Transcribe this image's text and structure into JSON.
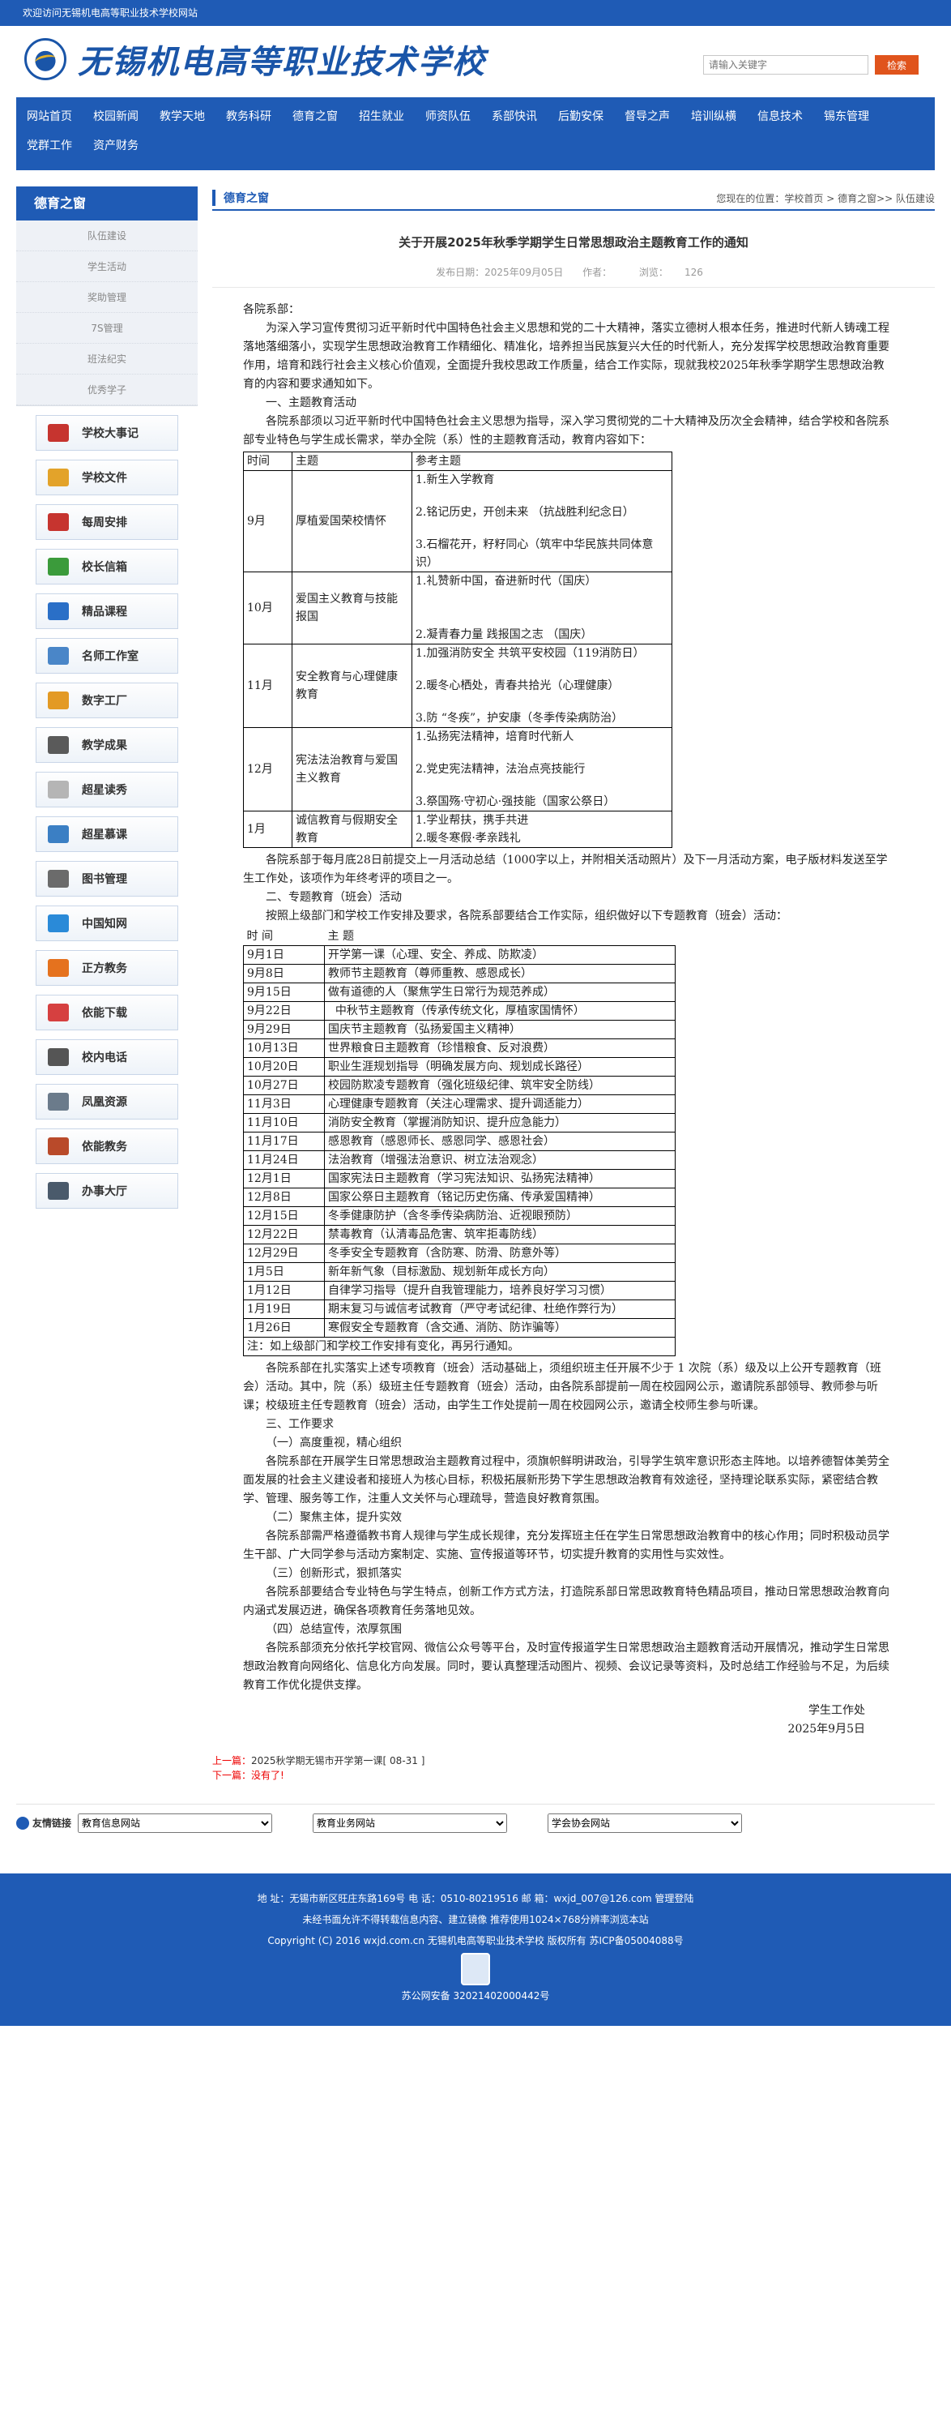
{
  "topbar": "欢迎访问无锡机电高等职业技术学校网站",
  "header": {
    "school_name": "无锡机电高等职业技术学校",
    "search_placeholder": "请输入关键字",
    "search_button": "检索"
  },
  "nav": [
    "网站首页",
    "校园新闻",
    "教学天地",
    "教务科研",
    "德育之窗",
    "招生就业",
    "师资队伍",
    "系部快讯",
    "后勤安保",
    "督导之声",
    "培训纵横",
    "信息技术",
    "锡东管理",
    "党群工作",
    "资产财务"
  ],
  "sidebar": {
    "title": "德育之窗",
    "menu": [
      "队伍建设",
      "学生活动",
      "奖助管理",
      "7S管理",
      "班法纪实",
      "优秀学子"
    ],
    "quick": [
      "学校大事记",
      "学校文件",
      "每周安排",
      "校长信箱",
      "精品课程",
      "名师工作室",
      "数字工厂",
      "教学成果",
      "超星读秀",
      "超星慕课",
      "图书管理",
      "中国知网",
      "正方教务",
      "依能下载",
      "校内电话",
      "凤凰资源",
      "依能教务",
      "办事大厅"
    ],
    "quick_colors": [
      "#c6342f",
      "#e3a32a",
      "#c6342f",
      "#3b9b3b",
      "#2a6fc7",
      "#4a86c8",
      "#e39a24",
      "#5a5a5a",
      "#b5b5b5",
      "#3b7fc4",
      "#6b6b6b",
      "#2a8ad8",
      "#e5721e",
      "#d64040",
      "#555555",
      "#6b7b8b",
      "#b94a2a",
      "#4a5a6b"
    ]
  },
  "content": {
    "section_title": "德育之窗",
    "breadcrumb": "您现在的位置：学校首页 > 德育之窗>> 队伍建设",
    "title": "关于开展2025年秋季学期学生日常思想政治主题教育工作的通知",
    "meta": {
      "date": "发布日期：2025年09月05日",
      "author": "作者：",
      "views_label": "浏览：",
      "views": "126"
    },
    "greeting": "各院系部：",
    "intro": "为深入学习宣传贯彻习近平新时代中国特色社会主义思想和党的二十大精神，落实立德树人根本任务，推进时代新人铸魂工程落地落细落小，实现学生思想政治教育工作精细化、精准化，培养担当民族复兴大任的时代新人，充分发挥学校思想政治教育重要作用，培育和践行社会主义核心价值观，全面提升我校思政工作质量，结合工作实际，现就我校2025年秋季学期学生思想政治教育的内容和要求通知如下。",
    "h1": "一、主题教育活动",
    "p1": "各院系部须以习近平新时代中国特色社会主义思想为指导，深入学习贯彻党的二十大精神及历次全会精神，结合学校和各院系部专业特色与学生成长需求，举办全院（系）性的主题教育活动，教育内容如下：",
    "table1_head": [
      "时间",
      "主题",
      "参考主题"
    ],
    "table1": [
      {
        "t": "9月",
        "theme": "厚植爱国荣校情怀",
        "refs": [
          "1.新生入学教育",
          "2.铭记历史，开创未来 （抗战胜利纪念日）",
          "3.石榴花开，籽籽同心（筑牢中华民族共同体意识）"
        ]
      },
      {
        "t": "10月",
        "theme": "爱国主义教育与技能报国",
        "refs": [
          "1.礼赞新中国，奋进新时代（国庆）",
          "2.凝青春力量 践报国之志 （国庆）"
        ]
      },
      {
        "t": "11月",
        "theme": "安全教育与心理健康教育",
        "refs": [
          "1.加强消防安全 共筑平安校园（119消防日）",
          "2.暖冬心栖处，青春共拾光（心理健康）",
          "3.防 “冬疾”，护安康（冬季传染病防治）"
        ]
      },
      {
        "t": "12月",
        "theme": "宪法法治教育与爱国主义教育",
        "refs": [
          "1.弘扬宪法精神，培育时代新人",
          "2.党史宪法精神，法治点亮技能行",
          "3.祭国殇·守初心·强技能（国家公祭日）"
        ]
      },
      {
        "t": "1月",
        "theme": "诚信教育与假期安全教育",
        "refs": [
          "1.学业帮扶，携手共进",
          "2.暖冬寒假·孝亲践礼"
        ]
      }
    ],
    "p2": "各院系部于每月底28日前提交上一月活动总结（1000字以上，并附相关活动照片）及下一月活动方案，电子版材料发送至学生工作处，该项作为年终考评的项目之一。",
    "h2": "二、专题教育（班会）活动",
    "p3": "按照上级部门和学校工作安排及要求，各院系部要结合工作实际，组织做好以下专题教育（班会）活动：",
    "table2_head": [
      "时  间",
      "主  题"
    ],
    "table2": [
      [
        "9月1日",
        "开学第一课（心理、安全、养成、防欺凌）"
      ],
      [
        "9月8日",
        "教师节主题教育（尊师重教、感恩成长）"
      ],
      [
        "9月15日",
        "做有道德的人（聚焦学生日常行为规范养成）"
      ],
      [
        "9月22日",
        "  中秋节主题教育（传承传统文化，厚植家国情怀）"
      ],
      [
        "9月29日",
        "国庆节主题教育（弘扬爱国主义精神）"
      ],
      [
        "10月13日",
        "世界粮食日主题教育（珍惜粮食、反对浪费）"
      ],
      [
        "10月20日",
        "职业生涯规划指导（明确发展方向、规划成长路径）"
      ],
      [
        "10月27日",
        "校园防欺凌专题教育（强化班级纪律、筑牢安全防线）"
      ],
      [
        "11月3日",
        "心理健康专题教育（关注心理需求、提升调适能力）"
      ],
      [
        "11月10日",
        "消防安全教育（掌握消防知识、提升应急能力）"
      ],
      [
        "11月17日",
        "感恩教育（感恩师长、感恩同学、感恩社会）"
      ],
      [
        "11月24日",
        "法治教育（增强法治意识、树立法治观念）"
      ],
      [
        "12月1日",
        "国家宪法日主题教育（学习宪法知识、弘扬宪法精神）"
      ],
      [
        "12月8日",
        "国家公祭日主题教育（铭记历史伤痛、传承爱国精神）"
      ],
      [
        "12月15日",
        "冬季健康防护（含冬季传染病防治、近视眼预防）"
      ],
      [
        "12月22日",
        "禁毒教育（认清毒品危害、筑牢拒毒防线）"
      ],
      [
        "12月29日",
        "冬季安全专题教育（含防寒、防滑、防意外等）"
      ],
      [
        "1月5日",
        "新年新气象（目标激励、规划新年成长方向）"
      ],
      [
        "1月12日",
        "自律学习指导（提升自我管理能力，培养良好学习习惯）"
      ],
      [
        "1月19日",
        "期末复习与诚信考试教育（严守考试纪律、杜绝作弊行为）"
      ],
      [
        "1月26日",
        "寒假安全专题教育（含交通、消防、防诈骗等）"
      ]
    ],
    "table2_note": "注：如上级部门和学校工作安排有变化，再另行通知。",
    "p4": "各院系部在扎实落实上述专项教育（班会）活动基础上，须组织班主任开展不少于 1 次院（系）级及以上公开专题教育（班会）活动。其中，院（系）级班主任专题教育（班会）活动，由各院系部提前一周在校园网公示，邀请院系部领导、教师参与听课；校级班主任专题教育（班会）活动，由学生工作处提前一周在校园网公示，邀请全校师生参与听课。",
    "h3": "三、工作要求",
    "s1": "（一）高度重视，精心组织",
    "s1p": "各院系部在开展学生日常思想政治主题教育过程中，须旗帜鲜明讲政治，引导学生筑牢意识形态主阵地。以培养德智体美劳全面发展的社会主义建设者和接班人为核心目标，积极拓展新形势下学生思想政治教育有效途径，坚持理论联系实际，紧密结合教学、管理、服务等工作，注重人文关怀与心理疏导，营造良好教育氛围。",
    "s2": "（二）聚焦主体，提升实效",
    "s2p": "各院系部需严格遵循教书育人规律与学生成长规律，充分发挥班主任在学生日常思想政治教育中的核心作用；同时积极动员学生干部、广大同学参与活动方案制定、实施、宣传报道等环节，切实提升教育的实用性与实效性。",
    "s3": "（三）创新形式，狠抓落实",
    "s3p": "各院系部要结合专业特色与学生特点，创新工作方式方法，打造院系部日常思政教育特色精品项目，推动日常思想政治教育向内涵式发展迈进，确保各项教育任务落地见效。",
    "s4": "（四）总结宣传，浓厚氛围",
    "s4p": "各院系部须充分依托学校官网、微信公众号等平台，及时宣传报道学生日常思想政治主题教育活动开展情况，推动学生日常思想政治教育向网络化、信息化方向发展。同时，要认真整理活动图片、视频、会议记录等资料，及时总结工作经验与不足，为后续教育工作优化提供支撑。",
    "sign_org": "学生工作处",
    "sign_date": "2025年9月5日",
    "prev_label": "上一篇：",
    "prev_text": "2025秋学期无锡市开学第一课[ 08-31 ]",
    "next_label": "下一篇：",
    "next_text": "没有了!"
  },
  "links": {
    "label": "友情链接",
    "selects": [
      "教育信息网站",
      "教育业务网站",
      "学会协会网站"
    ]
  },
  "footer": {
    "line1": "地 址：无锡市新区旺庄东路169号 电 话：0510-80219516 邮 箱：wxjd_007@126.com 管理登陆",
    "line2": "未经书面允许不得转载信息内容、建立镜像 推荐使用1024×768分辨率浏览本站",
    "line3": "Copyright (C) 2016 wxjd.com.cn 无锡机电高等职业技术学校 版权所有 苏ICP备05004088号",
    "line4": "苏公网安备 32021402000442号"
  }
}
